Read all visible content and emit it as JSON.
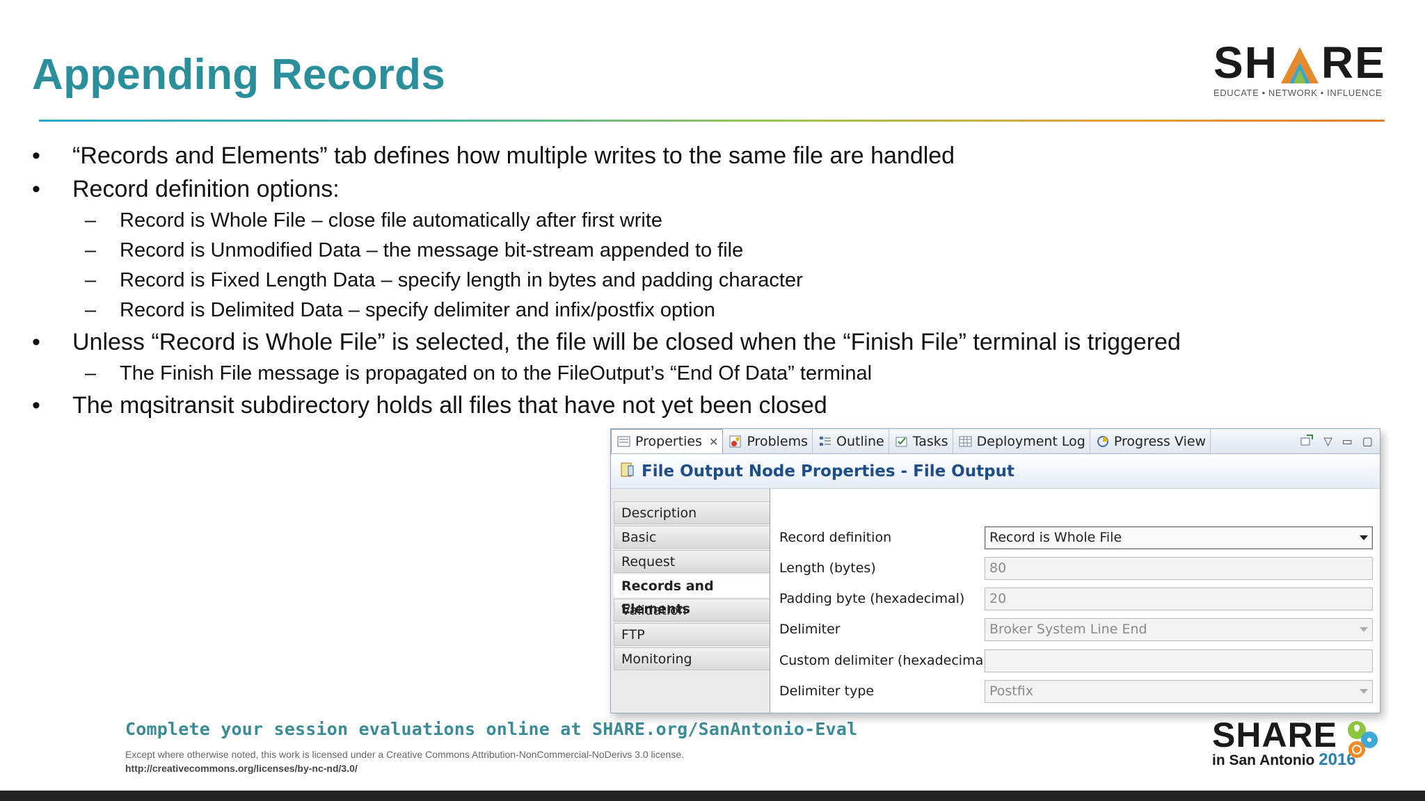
{
  "slide": {
    "title": "Appending Records",
    "logo_word": "SHARE",
    "logo_tagline": "EDUCATE • NETWORK • INFLUENCE",
    "bullets": [
      {
        "level": 1,
        "text": "“Records and Elements” tab defines how multiple writes to the same file are handled"
      },
      {
        "level": 1,
        "text": "Record definition options:"
      },
      {
        "level": 2,
        "text": "Record is Whole File – close file automatically after first write"
      },
      {
        "level": 2,
        "text": "Record is Unmodified Data – the message bit-stream appended to file"
      },
      {
        "level": 2,
        "text": "Record is Fixed Length Data – specify length in bytes and padding character"
      },
      {
        "level": 2,
        "text": "Record is Delimited Data – specify delimiter and infix/postfix option"
      },
      {
        "level": 1,
        "text": "Unless “Record is Whole File” is selected, the file will be closed when the “Finish File” terminal is triggered"
      },
      {
        "level": 2,
        "text": "The Finish File message is propagated on to the FileOutput’s “End Of Data” terminal"
      },
      {
        "level": 1,
        "text": "The mqsitransit subdirectory holds all files that have not yet been closed"
      }
    ]
  },
  "panel": {
    "tabs": [
      {
        "label": "Properties",
        "icon": "properties-icon",
        "active": true
      },
      {
        "label": "Problems",
        "icon": "problems-icon"
      },
      {
        "label": "Outline",
        "icon": "outline-icon"
      },
      {
        "label": "Tasks",
        "icon": "tasks-icon"
      },
      {
        "label": "Deployment Log",
        "icon": "deployment-log-icon"
      },
      {
        "label": "Progress View",
        "icon": "progress-view-icon"
      }
    ],
    "heading": "File Output Node Properties - File Output",
    "sidebar": [
      "Description",
      "Basic",
      "Request",
      "Records and Elements",
      "Validation",
      "FTP",
      "Monitoring"
    ],
    "active_section": "Records and Elements",
    "fields": [
      {
        "label": "Record definition",
        "value": "Record is Whole File",
        "type": "select",
        "enabled": true
      },
      {
        "label": "Length (bytes)",
        "value": "80",
        "type": "text",
        "enabled": false
      },
      {
        "label": "Padding byte (hexadecimal)",
        "value": "20",
        "type": "text",
        "enabled": false
      },
      {
        "label": "Delimiter",
        "value": "Broker System Line End",
        "type": "select",
        "enabled": false
      },
      {
        "label": "Custom delimiter (hexadecimal)",
        "value": "",
        "type": "text",
        "enabled": false
      },
      {
        "label": "Delimiter type",
        "value": "Postfix",
        "type": "select",
        "enabled": false
      }
    ],
    "colors": {
      "heading": "#1e4e8a",
      "title": "#2a8f9a"
    }
  },
  "footer": {
    "cta": "Complete your session evaluations online at SHARE.org/SanAntonio-Eval",
    "license": "Except where otherwise noted, this work is licensed under a Creative Commons Attribution-NonCommercial-NoDerivs 3.0 license.",
    "url": "http://creativecommons.org/licenses/by-nc-nd/3.0/",
    "event_word": "SHARE",
    "event_city": "in San Antonio",
    "event_year": "2016"
  }
}
